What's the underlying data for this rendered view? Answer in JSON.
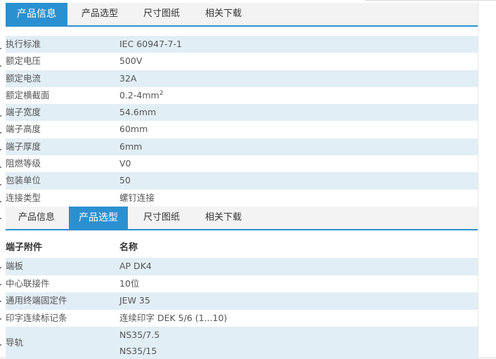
{
  "tabs1": [
    {
      "label": "产品信息",
      "active": true
    },
    {
      "label": "产品选型",
      "active": false
    },
    {
      "label": "尺寸图纸",
      "active": false
    },
    {
      "label": "相关下载",
      "active": false
    }
  ],
  "specs": [
    {
      "label": "执行标准",
      "value": "IEC 60947-7-1"
    },
    {
      "label": "额定电压",
      "value": "500V"
    },
    {
      "label": "额定电流",
      "value": "32A"
    },
    {
      "label": "额定横截面",
      "value": "0.2-4mm",
      "sup": "2"
    },
    {
      "label": "端子宽度",
      "value": "54.6mm"
    },
    {
      "label": "端子高度",
      "value": "60mm"
    },
    {
      "label": "端子厚度",
      "value": "6mm"
    },
    {
      "label": "阻燃等级",
      "value": "V0"
    },
    {
      "label": "包装单位",
      "value": "50"
    },
    {
      "label": "连接类型",
      "value": "螺钉连接"
    }
  ],
  "tabs2": [
    {
      "label": "产品信息",
      "active": false
    },
    {
      "label": "产品选型",
      "active": true
    },
    {
      "label": "尺寸图纸",
      "active": false
    },
    {
      "label": "相关下载",
      "active": false
    }
  ],
  "accessories": {
    "header": {
      "col1": "端子附件",
      "col2": "名称"
    },
    "rows": [
      {
        "label": "端板",
        "value": "AP DK4"
      },
      {
        "label": "中心联接件",
        "value": "10位"
      },
      {
        "label": "通用终端固定件",
        "value": "JEW 35"
      },
      {
        "label": "印字连续标记条",
        "value": "连续印字 DEK 5/6 (1...10)"
      },
      {
        "label": "导轨",
        "values": [
          "NS35/7.5",
          "NS35/15"
        ]
      }
    ]
  },
  "colors": {
    "accent": "#2b90d0",
    "row_shade": "#e2eef6",
    "tabbar_bg": "#f3f3f3"
  }
}
